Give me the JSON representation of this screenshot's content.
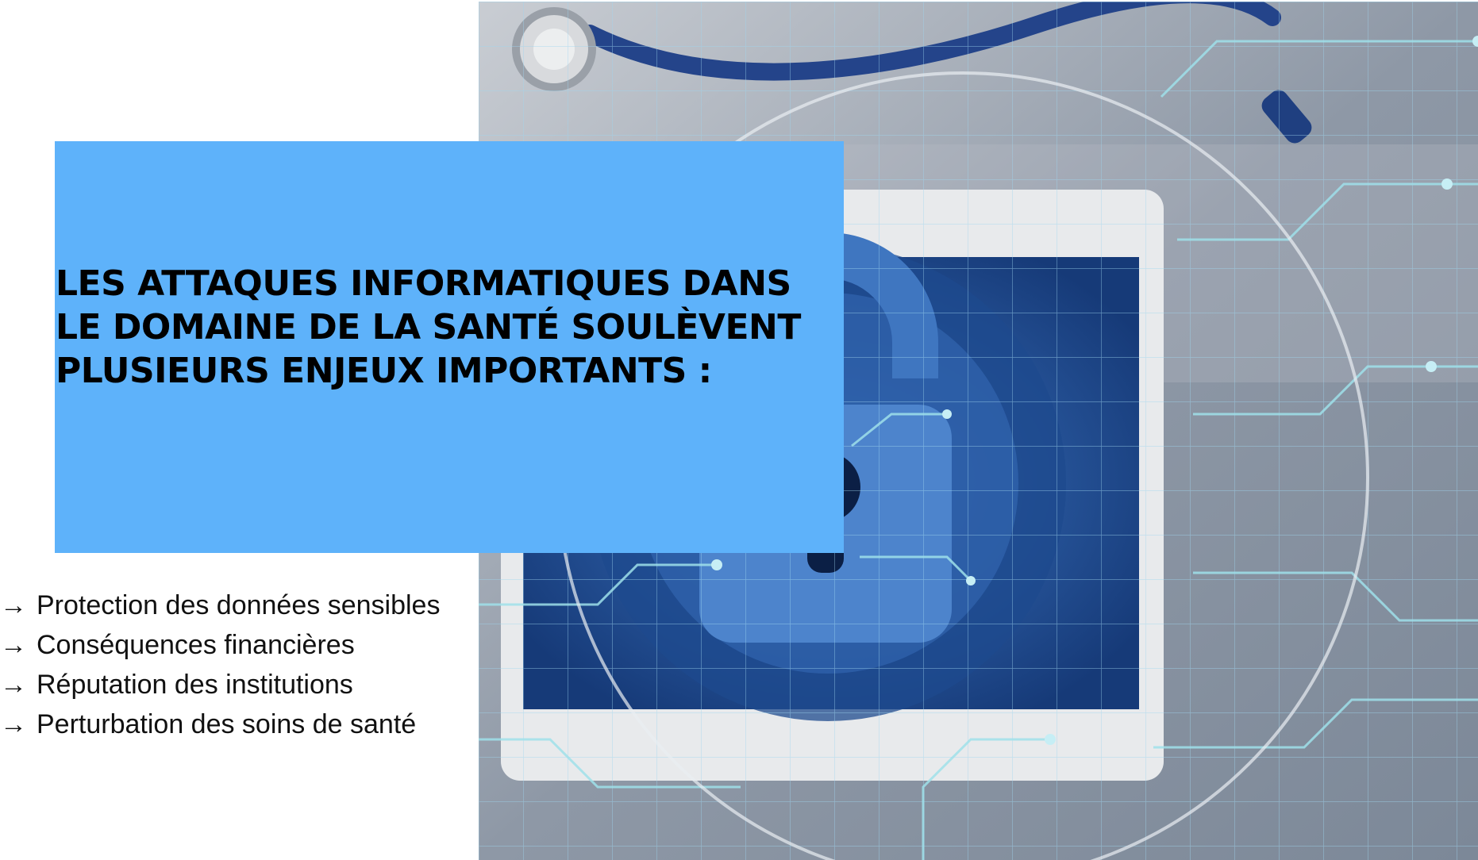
{
  "title": {
    "lines": [
      "LES ATTAQUES INFORMATIQUES DANS",
      "LE DOMAINE DE LA SANTÉ SOULÈVENT",
      "PLUSIEURS ENJEUX IMPORTANTS :"
    ]
  },
  "bullets": {
    "marker": "→",
    "items": [
      "Protection des données sensibles",
      "Conséquences financières",
      "Réputation des institutions",
      "Perturbation des soins de santé"
    ]
  },
  "colors": {
    "title_box": "#5eb2fa",
    "text": "#000000",
    "image_primary": "#1f4f96",
    "circuit_lines": "#8fd3e8"
  },
  "icons": {
    "hero": "padlock-tablet-stethoscope-image"
  }
}
